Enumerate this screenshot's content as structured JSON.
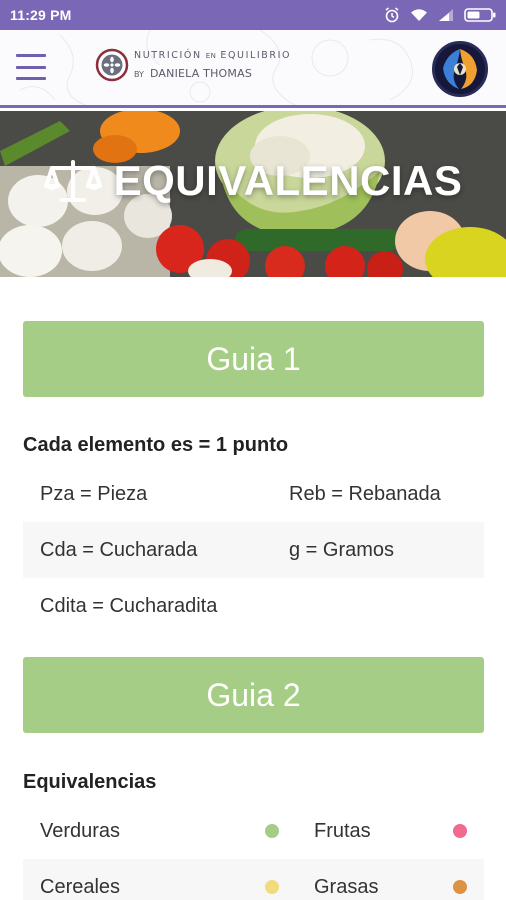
{
  "status_bar": {
    "time": "11:29 PM"
  },
  "app_bar": {
    "brand": {
      "line1_a": "NUTRICIÓN",
      "line1_small": "EN",
      "line1_b": "EQUILIBRIO",
      "by": "BY",
      "name": "DANIELA THOMAS"
    },
    "menu_icon": "hamburger-icon",
    "avatar_icon": "profile-avatar"
  },
  "hero": {
    "title": "EQUIVALENCIAS",
    "icon": "scale-icon"
  },
  "guia1": {
    "label": "Guia 1",
    "section_title": "Cada elemento es = 1 punto",
    "rows": [
      [
        "Pza = Pieza",
        "Reb = Rebanada"
      ],
      [
        "Cda = Cucharada",
        "g = Gramos"
      ],
      [
        "Cdita = Cucharadita",
        ""
      ]
    ]
  },
  "guia2": {
    "label": "Guia 2",
    "section_title": "Equivalencias",
    "rows": [
      [
        {
          "label": "Verduras",
          "color": "#a5cd86"
        },
        {
          "label": "Frutas",
          "color": "#f06b8e"
        }
      ],
      [
        {
          "label": "Cereales",
          "color": "#f2db7b"
        },
        {
          "label": "Grasas",
          "color": "#dd9244"
        }
      ]
    ]
  },
  "colors": {
    "primary": "#7a67b5",
    "accent_green": "#a5cd86"
  }
}
